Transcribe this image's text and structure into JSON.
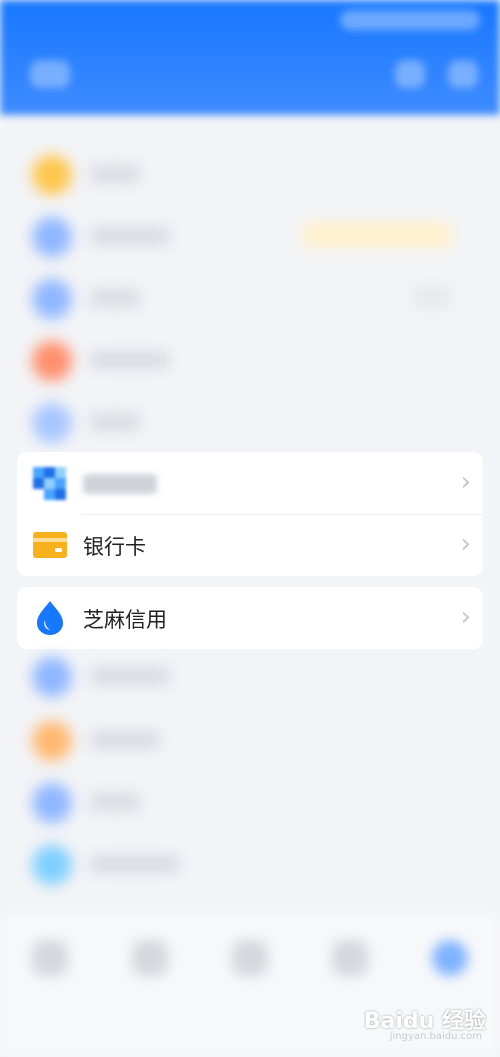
{
  "menu": {
    "items": [
      {
        "label": "",
        "icon": "grid-icon"
      },
      {
        "label": "银行卡",
        "icon": "bank-card-icon"
      }
    ],
    "credit": {
      "label": "芝麻信用",
      "icon": "sesame-credit-icon"
    }
  },
  "watermark": {
    "brand": "Baidu 经验",
    "url": "jingyan.baidu.com"
  },
  "colors": {
    "header": "#1677ff",
    "card_icon": "#f7b11b",
    "credit_icon": "#1677ff"
  }
}
